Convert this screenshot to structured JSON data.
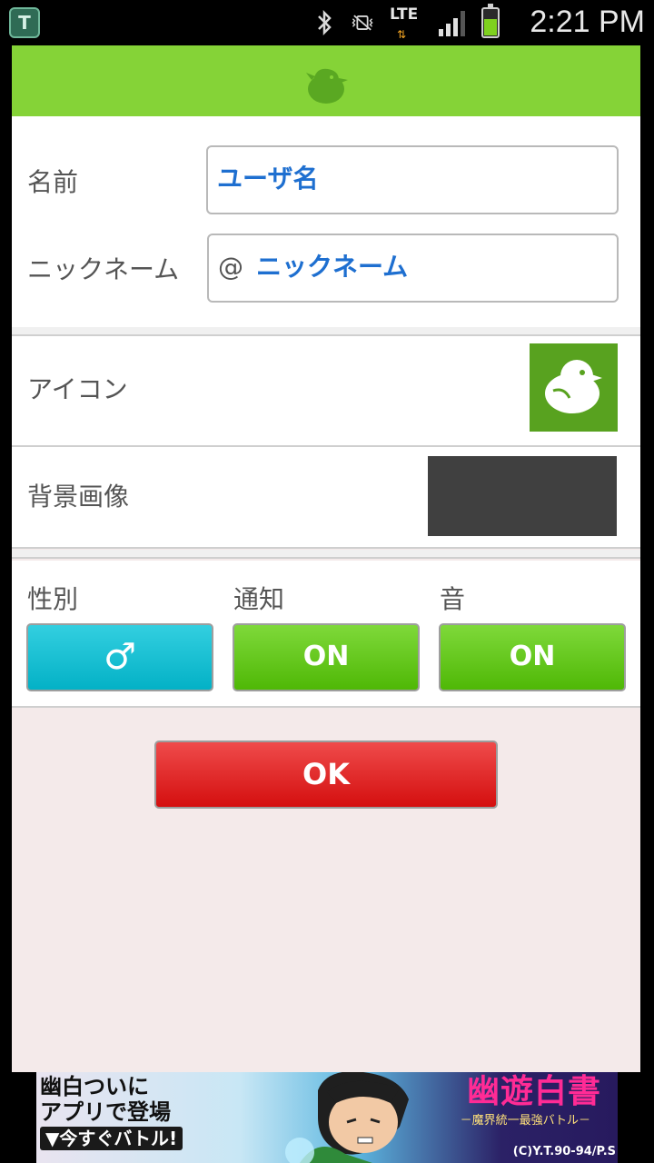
{
  "status_bar": {
    "time": "2:21 PM",
    "network": "LTE",
    "app_badge": "T"
  },
  "form": {
    "name_label": "名前",
    "name_value": "ユーザ名",
    "nickname_label": "ニックネーム",
    "nickname_prefix": "@",
    "nickname_value": "ニックネーム"
  },
  "icon_row": {
    "label": "アイコン"
  },
  "background_row": {
    "label": "背景画像"
  },
  "settings": {
    "gender_label": "性別",
    "gender_value": "♂",
    "notify_label": "通知",
    "notify_value": "ON",
    "sound_label": "音",
    "sound_value": "ON"
  },
  "ok_button": {
    "label": "OK"
  },
  "ad": {
    "line1": "幽白ついに",
    "line2": "アプリで登場",
    "line3": "▼今すぐバトル!",
    "title": "幽遊白書",
    "subtitle": "－魔界統一最強バトル－",
    "copyright": "(C)Y.T.90-94/P.S"
  },
  "colors": {
    "header_green": "#85d337",
    "on_green": "#5cc212",
    "gender_cyan": "#0ab8cc",
    "ok_red": "#e01b1b",
    "input_text_blue": "#1e6fd0"
  }
}
